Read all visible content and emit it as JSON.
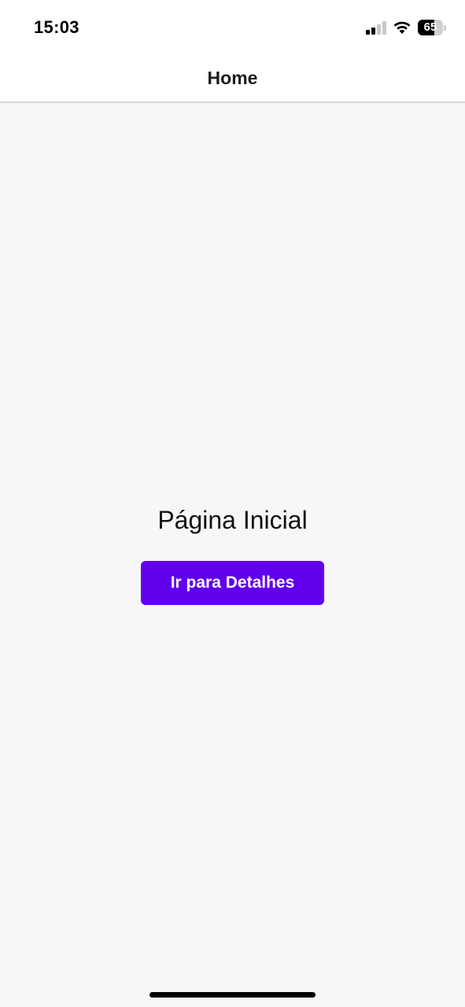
{
  "status_bar": {
    "time": "15:03",
    "signal_icon": "cellular-signal-icon",
    "signal_bars_active": 2,
    "signal_bars_total": 4,
    "wifi_icon": "wifi-icon",
    "battery_icon": "battery-icon",
    "battery_level": "65"
  },
  "nav_bar": {
    "title": "Home"
  },
  "main": {
    "heading": "Página Inicial",
    "button_label": "Ir para Detalhes"
  },
  "colors": {
    "accent": "#6200ee",
    "background": "#f7f7f7",
    "header_background": "#ffffff"
  }
}
